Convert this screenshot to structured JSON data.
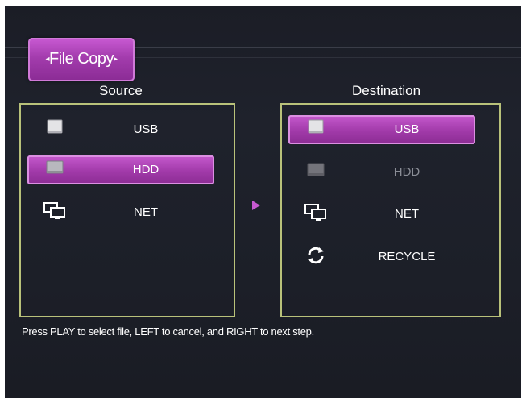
{
  "title": "File Copy",
  "source": {
    "heading": "Source",
    "items": [
      {
        "label": "USB",
        "icon": "usb-drive-icon",
        "selected": false,
        "dim": false
      },
      {
        "label": "HDD",
        "icon": "hdd-icon",
        "selected": true,
        "dim": false
      },
      {
        "label": "NET",
        "icon": "network-icon",
        "selected": false,
        "dim": false
      }
    ]
  },
  "destination": {
    "heading": "Destination",
    "items": [
      {
        "label": "USB",
        "icon": "usb-drive-icon",
        "selected": true,
        "dim": false
      },
      {
        "label": "HDD",
        "icon": "hdd-icon",
        "selected": false,
        "dim": true
      },
      {
        "label": "NET",
        "icon": "network-icon",
        "selected": false,
        "dim": false
      },
      {
        "label": "RECYCLE",
        "icon": "recycle-icon",
        "selected": false,
        "dim": false
      }
    ]
  },
  "help_text": "Press PLAY to select file, LEFT to cancel, and RIGHT to next step.",
  "colors": {
    "accent": "#a33cad",
    "panel_border": "#b9c27a",
    "background": "#1d2029"
  }
}
